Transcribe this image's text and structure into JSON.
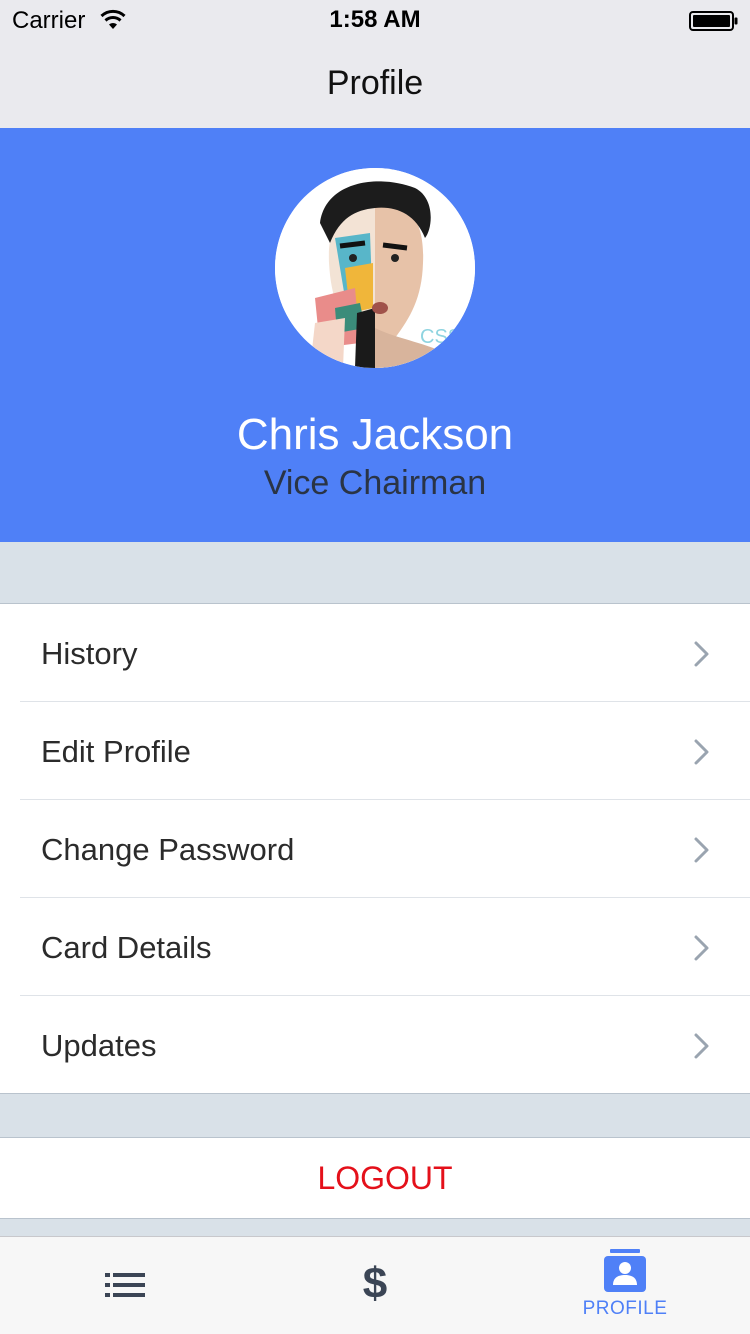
{
  "status_bar": {
    "carrier": "Carrier",
    "time": "1:58 AM",
    "icons": [
      "wifi-icon",
      "battery-icon"
    ]
  },
  "nav": {
    "title": "Profile"
  },
  "profile": {
    "name": "Chris Jackson",
    "role": "Vice Chairman",
    "avatar_icon": "avatar-photo",
    "header_color": "#4f80f7"
  },
  "menu": {
    "items": [
      {
        "label": "History",
        "icon": "chevron-right-icon"
      },
      {
        "label": "Edit Profile",
        "icon": "chevron-right-icon"
      },
      {
        "label": "Change Password",
        "icon": "chevron-right-icon"
      },
      {
        "label": "Card Details",
        "icon": "chevron-right-icon"
      },
      {
        "label": "Updates",
        "icon": "chevron-right-icon"
      }
    ]
  },
  "logout": {
    "label": "LOGOUT",
    "color": "#e4101a"
  },
  "tab_bar": {
    "tabs": [
      {
        "icon": "list-icon",
        "label": "",
        "selected": false
      },
      {
        "icon": "dollar-icon",
        "glyph": "$",
        "label": "",
        "selected": false
      },
      {
        "icon": "profile-card-icon",
        "label": "PROFILE",
        "selected": true
      }
    ],
    "accent_color": "#4f80f7"
  }
}
